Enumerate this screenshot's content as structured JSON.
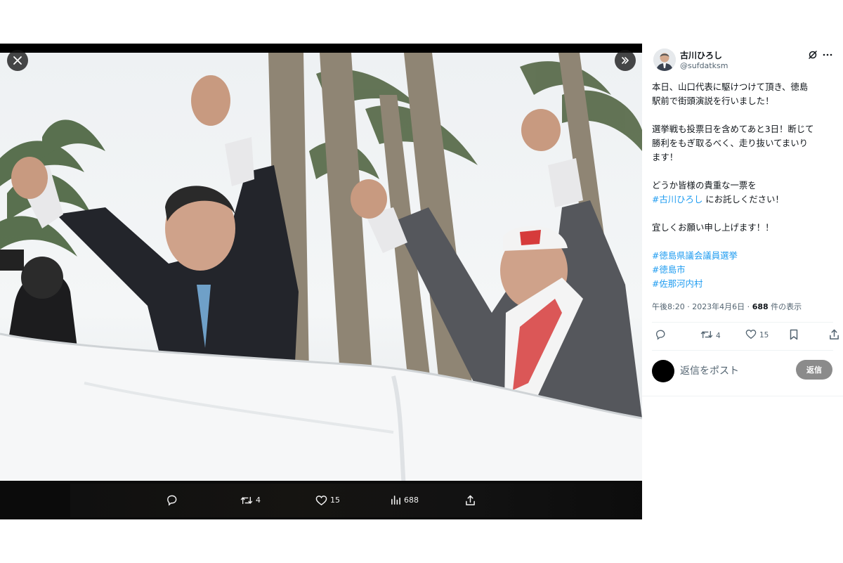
{
  "viewer": {
    "close_icon": "close-icon",
    "expand_icon": "expand-panel-icon",
    "actions": {
      "reply_count": "",
      "retweet_count": "4",
      "like_count": "15",
      "view_count": "688"
    }
  },
  "tweet": {
    "author": {
      "name": "古川ひろし",
      "handle": "@sufdatksm"
    },
    "text": {
      "line1": "本日、山口代表に駆けつけて頂き、徳島",
      "line2": "駅前で街頭演説を行いました！",
      "line3": "選挙戦も投票日を含めてあと3日！断じて",
      "line4": "勝利をもぎ取るべく、走り抜いてまいり",
      "line5": "ます！",
      "line6": "どうか皆様の貴重な一票を",
      "tag_furukawa": "#古川ひろし",
      "line7_suffix": " にお託しください！",
      "line8": "宜しくお願い申し上げます！！",
      "tag1": "#徳島県議会議員選挙",
      "tag2": "#徳島市",
      "tag3": "#佐那河内村"
    },
    "meta": {
      "timestamp": "午後8:20 · 2023年4月6日 · ",
      "views": "688",
      "views_suffix": " 件の表示"
    },
    "stats": {
      "retweets": "4",
      "likes": "15"
    },
    "reply": {
      "placeholder": "返信をポスト",
      "button": "返信"
    }
  },
  "colors": {
    "link": "#1d9bf0",
    "text": "#0f1419",
    "muted": "#536471",
    "viewer_bg": "#000000",
    "reply_button": "#8b8b8b"
  }
}
